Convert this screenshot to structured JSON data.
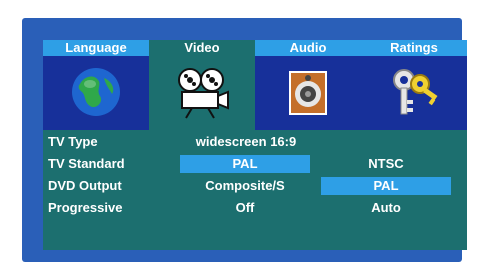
{
  "tabs": [
    {
      "label": "Language",
      "icon": "globe-icon",
      "active": false
    },
    {
      "label": "Video",
      "icon": "film-projector-icon",
      "active": true
    },
    {
      "label": "Audio",
      "icon": "speaker-icon",
      "active": false
    },
    {
      "label": "Ratings",
      "icon": "keys-icon",
      "active": false
    }
  ],
  "settings": {
    "tv_type": {
      "label": "TV Type",
      "value": "widescreen 16:9"
    },
    "tv_standard": {
      "label": "TV Standard",
      "option1": "PAL",
      "option2": "NTSC",
      "selected": "PAL"
    },
    "dvd_output": {
      "label": "DVD Output",
      "option1": "Composite/S",
      "option2": "PAL",
      "selected": "PAL"
    },
    "progressive": {
      "label": "Progressive",
      "option1": "Off",
      "option2": "Auto"
    }
  },
  "colors": {
    "screen_bg": "#2a5fb8",
    "panel_bg": "#1c6f6f",
    "tab_bg": "#17309a",
    "highlight": "#2e9fe6"
  }
}
